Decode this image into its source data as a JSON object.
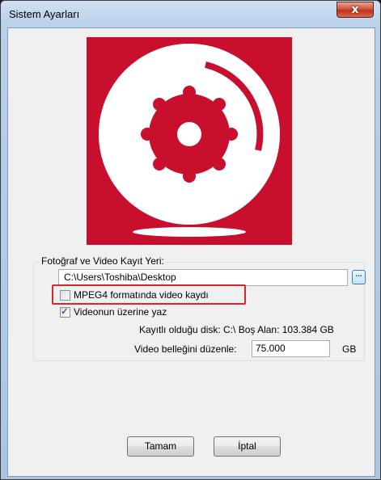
{
  "window": {
    "title": "Sistem Ayarları",
    "close_label": "x"
  },
  "logo": {
    "brand_color": "#c8102e",
    "icon": "camera-reel-icon"
  },
  "storage": {
    "group_label": "Fotoğraf ve Video Kayıt Yeri:",
    "path_value": "C:\\Users\\Toshiba\\Desktop",
    "browse_label": "...",
    "mpeg4_label": "MPEG4 formatında video kaydı",
    "mpeg4_checked": false,
    "overwrite_label": "Videonun üzerine yaz",
    "overwrite_checked": true,
    "disk_info": "Kayıtlı olduğu disk: C:\\ Boş Alan: 103.384 GB",
    "memory_label": "Video belleğini düzenle:",
    "memory_value": "75.000",
    "memory_unit": "GB"
  },
  "buttons": {
    "ok": "Tamam",
    "cancel": "İptal"
  }
}
